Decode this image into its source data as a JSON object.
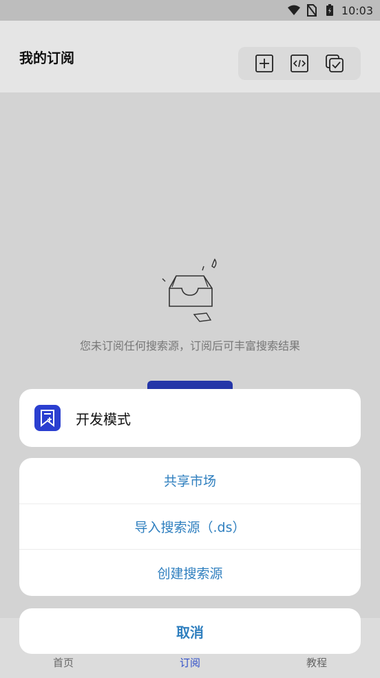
{
  "status_bar": {
    "time": "10:03"
  },
  "header": {
    "title": "我的订阅"
  },
  "empty_state": {
    "message": "您未订阅任何搜索源，订阅后可丰富搜索结果"
  },
  "bottom_nav": {
    "items": [
      {
        "label": "首页"
      },
      {
        "label": "订阅"
      },
      {
        "label": "教程"
      }
    ]
  },
  "action_sheet": {
    "dev_mode": {
      "label": "开发模式",
      "icon": "bookmark-add-icon"
    },
    "items": [
      {
        "label": "共享市场"
      },
      {
        "label": "导入搜索源（.ds）"
      },
      {
        "label": "创建搜索源"
      }
    ],
    "cancel_label": "取消"
  },
  "colors": {
    "accent_blue": "#2b3fd0",
    "menu_text_blue": "#2f7fbf",
    "nav_active": "#3150c9"
  }
}
